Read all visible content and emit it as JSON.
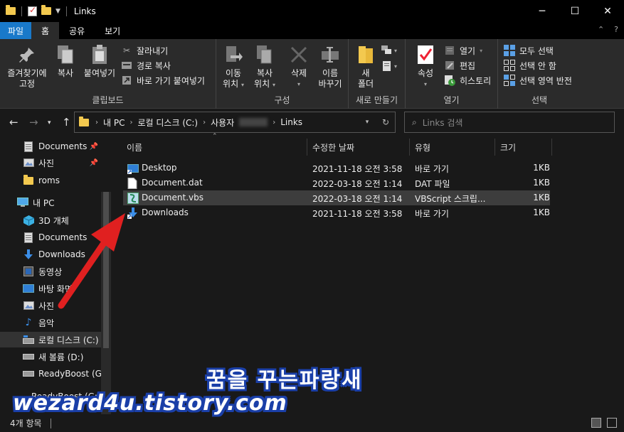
{
  "window": {
    "title": "Links",
    "controls": [
      "─",
      "☐",
      "✕"
    ]
  },
  "ribbon_tabs": [
    "파일",
    "홈",
    "공유",
    "보기"
  ],
  "ribbon": {
    "clipboard": {
      "pin_label_1": "즐겨찾기에",
      "pin_label_2": "고정",
      "copy": "복사",
      "paste": "붙여넣기",
      "cut": "잘라내기",
      "copy_path": "경로 복사",
      "paste_shortcut": "바로 가기 붙여넣기",
      "group": "클립보드"
    },
    "organize": {
      "move_1": "이동",
      "move_2": "위치",
      "copy_1": "복사",
      "copy_2": "위치",
      "delete": "삭제",
      "rename_1": "이름",
      "rename_2": "바꾸기",
      "group": "구성"
    },
    "new": {
      "new_folder_1": "새",
      "new_folder_2": "폴더",
      "group": "새로 만들기"
    },
    "open": {
      "properties": "속성",
      "open": "열기",
      "edit": "편집",
      "history": "히스토리",
      "group": "열기"
    },
    "select": {
      "select_all": "모두 선택",
      "select_none": "선택 안 함",
      "invert": "선택 영역 반전",
      "group": "선택"
    }
  },
  "address": {
    "crumbs": [
      "내 PC",
      "로컬 디스크 (C:)",
      "사용자",
      "Links"
    ],
    "search_placeholder": "Links 검색"
  },
  "sidebar": {
    "items": [
      {
        "label": "Documents",
        "pinned": true
      },
      {
        "label": "사진",
        "pinned": true
      },
      {
        "label": "roms"
      },
      {
        "label": "내 PC"
      },
      {
        "label": "3D 개체"
      },
      {
        "label": "Documents"
      },
      {
        "label": "Downloads"
      },
      {
        "label": "동영상"
      },
      {
        "label": "바탕 화면"
      },
      {
        "label": "사진"
      },
      {
        "label": "음악"
      },
      {
        "label": "로컬 디스크 (C:)"
      },
      {
        "label": "새 볼륨 (D:)"
      },
      {
        "label": "ReadyBoost (G:)"
      },
      {
        "label": "ReadyBoost (G:)"
      }
    ]
  },
  "columns": {
    "name": "이름",
    "modified": "수정한 날짜",
    "type": "유형",
    "size": "크기"
  },
  "files": [
    {
      "name": "Desktop",
      "modified": "2021-11-18 오전 3:58",
      "type": "바로 가기",
      "size": "1KB",
      "icon": "desktop-shortcut-icon"
    },
    {
      "name": "Document.dat",
      "modified": "2022-03-18 오전 1:14",
      "type": "DAT 파일",
      "size": "1KB",
      "icon": "blank-file-icon"
    },
    {
      "name": "Document.vbs",
      "modified": "2022-03-18 오전 1:14",
      "type": "VBScript 스크립...",
      "size": "1KB",
      "icon": "vbscript-file-icon"
    },
    {
      "name": "Downloads",
      "modified": "2021-11-18 오전 3:58",
      "type": "바로 가기",
      "size": "1KB",
      "icon": "downloads-shortcut-icon"
    }
  ],
  "status": {
    "item_count": "4개 항목"
  },
  "watermark": {
    "line1": "꿈을 꾸는파랑새",
    "line2": "wezard4u.tistory.com"
  },
  "colors": {
    "accent": "#1979ca",
    "arrow": "#e02020",
    "folder": "#f3c94f",
    "background": "#191919"
  }
}
